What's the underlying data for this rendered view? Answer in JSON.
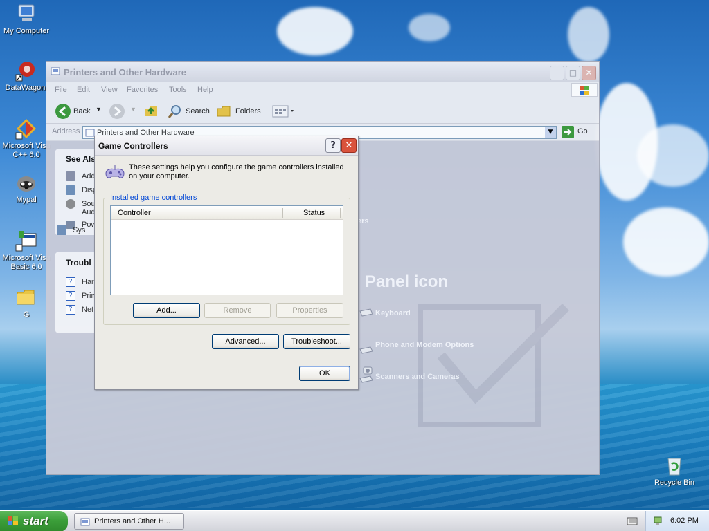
{
  "desktop": {
    "icons": [
      {
        "label": "My Computer"
      },
      {
        "label": "DataWagon."
      },
      {
        "label": "Microsoft Visu C++ 6.0"
      },
      {
        "label": "Mypal"
      },
      {
        "label": "Microsoft Visu Basic 6.0"
      },
      {
        "label": "G"
      },
      {
        "label": "Recycle Bin"
      }
    ]
  },
  "explorer": {
    "title": "Printers and Other Hardware",
    "menu": [
      "File",
      "Edit",
      "View",
      "Favorites",
      "Tools",
      "Help"
    ],
    "toolbar": {
      "back": "Back",
      "search": "Search",
      "folders": "Folders"
    },
    "address_label": "Address",
    "address_value": "Printers and Other Hardware",
    "go_label": "Go",
    "see_also_title": "See Als",
    "see_also_items": [
      "Add",
      "Disp",
      "Sou Aud",
      "Pow",
      "Sys"
    ],
    "troubleshoot_title": "Troubl",
    "troubleshoot_items": [
      "Har",
      "Prin",
      "Net"
    ],
    "content": {
      "partial_text": "ers",
      "heading": "Panel icon",
      "items": [
        "Keyboard",
        "Phone and Modem Options",
        "Scanners and Cameras"
      ]
    }
  },
  "dialog": {
    "title": "Game Controllers",
    "description": "These settings help you configure the game controllers installed on your computer.",
    "group_label": "Installed game controllers",
    "columns": [
      "Controller",
      "Status"
    ],
    "rows": [],
    "buttons": {
      "add": "Add...",
      "remove": "Remove",
      "properties": "Properties",
      "advanced": "Advanced...",
      "troubleshoot": "Troubleshoot...",
      "ok": "OK"
    }
  },
  "taskbar": {
    "start_label": "start",
    "task_label": "Printers and Other H...",
    "clock": "6:02 PM"
  }
}
